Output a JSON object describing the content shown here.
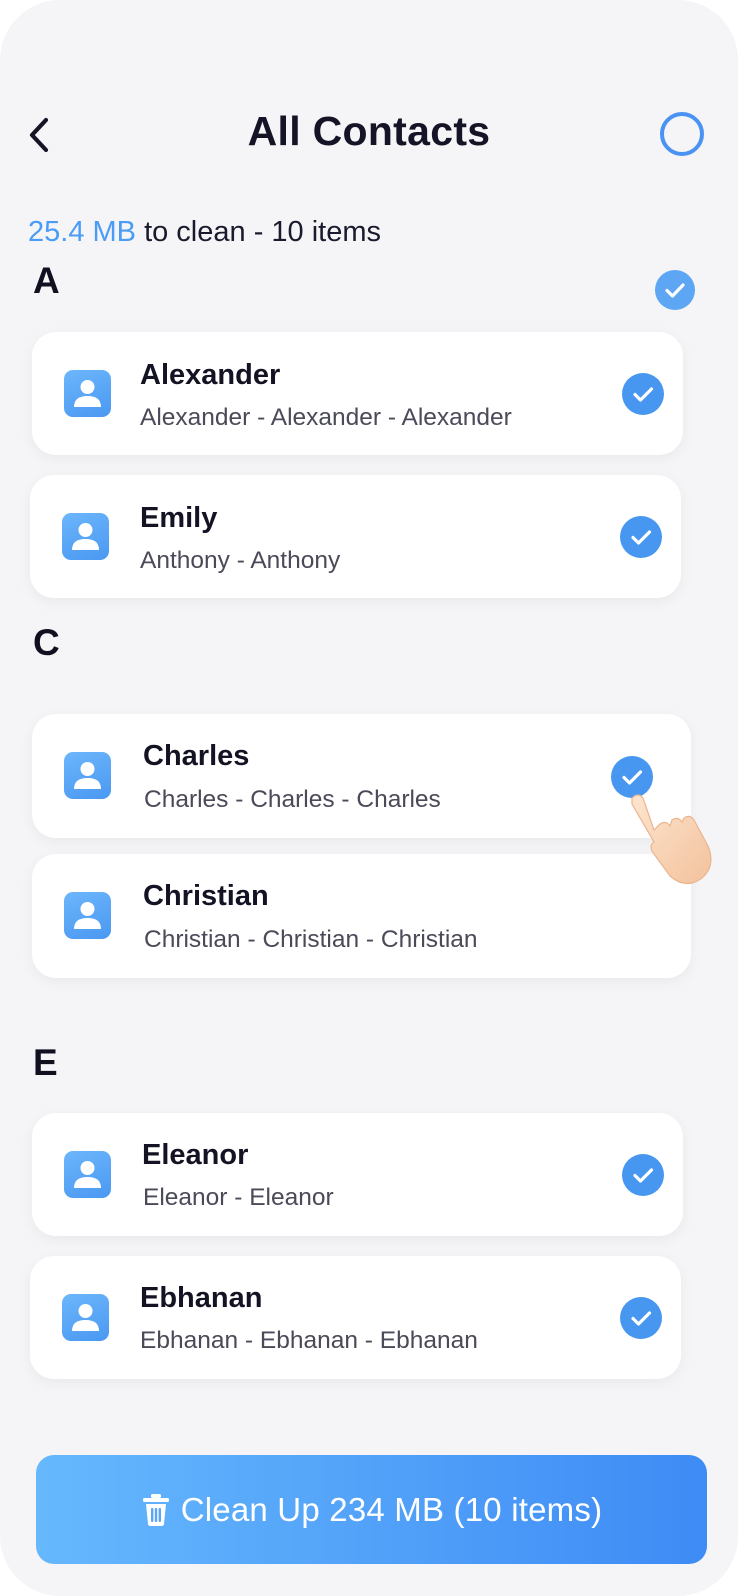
{
  "header": {
    "title": "All Contacts"
  },
  "summary": {
    "size": "25.4 MB",
    "rest": "to clean - 10 items"
  },
  "sections": [
    {
      "letter": "A",
      "contacts": [
        {
          "name": "Alexander",
          "duplicates": "Alexander - Alexander - Alexander",
          "checked": true
        },
        {
          "name": "Emily",
          "duplicates": "Anthony - Anthony",
          "checked": true
        }
      ]
    },
    {
      "letter": "C",
      "contacts": [
        {
          "name": "Charles",
          "duplicates": "Charles - Charles - Charles",
          "checked": true
        },
        {
          "name": "Christian",
          "duplicates": "Christian - Christian - Christian",
          "checked": false
        }
      ]
    },
    {
      "letter": "E",
      "contacts": [
        {
          "name": "Eleanor",
          "duplicates": "Eleanor - Eleanor",
          "checked": true
        },
        {
          "name": "Ebhanan",
          "duplicates": "Ebhanan - Ebhanan - Ebhanan",
          "checked": true
        }
      ]
    }
  ],
  "clean_button": {
    "label": "Clean Up 234 MB (10 items)"
  },
  "colors": {
    "accent": "#4797f0",
    "summary_size": "#4a9cf5",
    "background": "#f5f5f7",
    "card": "#ffffff"
  },
  "icons": [
    "back-chevron-icon",
    "select-all-circle-icon",
    "checkmark-icon",
    "contact-person-icon",
    "pointing-hand-icon",
    "trash-icon"
  ]
}
